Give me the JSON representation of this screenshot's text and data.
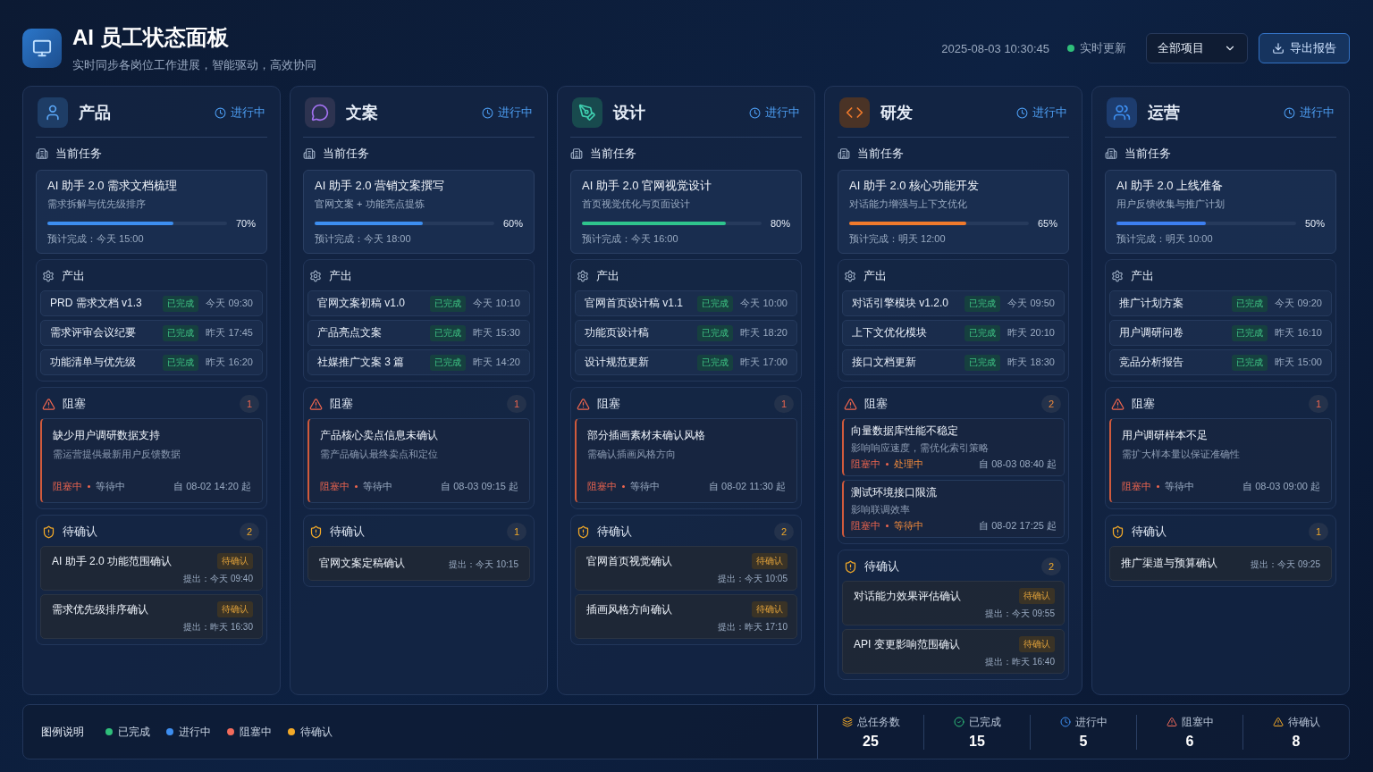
{
  "header": {
    "title": "AI 员工状态面板",
    "subtitle": "实时同步各岗位工作进展，智能驱动，高效协同",
    "datetime": "2025-08-03 10:30:45",
    "live": {
      "label": "实时更新",
      "color": "#2fbf7a"
    },
    "project_select": "全部项目",
    "export_button": "导出报告"
  },
  "columns": [
    {
      "name": "产品",
      "kind": "user",
      "status": "进行中",
      "task_label": "当前任务",
      "task": {
        "title": "AI 助手 2.0 需求文档梳理",
        "desc": "需求拆解与优先级排序",
        "level": 0.7,
        "percent": "70%",
        "color": "#3d8ef0",
        "eta": "预计完成：今天 15:00"
      },
      "outputs": {
        "label": "产出",
        "items": [
          {
            "name": "PRD 需求文档 v1.3",
            "status": "已完成",
            "time": "今天 09:30"
          },
          {
            "name": "需求评审会议纪要",
            "status": "已完成",
            "time": "昨天 17:45"
          },
          {
            "name": "功能清单与优先级",
            "status": "已完成",
            "time": "昨天 16:20"
          }
        ]
      },
      "blockers": {
        "label": "阻塞",
        "count": "1",
        "items": [
          {
            "kind": "spaced",
            "title": "缺少用户调研数据支持",
            "desc": "需运营提供最新用户反馈数据",
            "state": "阻塞中",
            "sub": "等待中",
            "since": "自 08-02 14:20 起"
          }
        ]
      },
      "pending": {
        "label": "待确认",
        "count": "2",
        "items": [
          {
            "kind": "stacked",
            "title": "AI 助手 2.0 功能范围确认",
            "tag": "待确认",
            "time": "提出：今天 09:40"
          },
          {
            "kind": "stacked",
            "title": "需求优先级排序确认",
            "tag": "待确认",
            "time": "提出：昨天 16:30"
          }
        ]
      }
    },
    {
      "name": "文案",
      "kind": "chat",
      "status": "进行中",
      "task_label": "当前任务",
      "task": {
        "title": "AI 助手 2.0 营销文案撰写",
        "desc": "官网文案 + 功能亮点提炼",
        "level": 0.6,
        "percent": "60%",
        "color": "#3d8ef0",
        "eta": "预计完成：今天 18:00"
      },
      "outputs": {
        "label": "产出",
        "items": [
          {
            "name": "官网文案初稿 v1.0",
            "status": "已完成",
            "time": "今天 10:10"
          },
          {
            "name": "产品亮点文案",
            "status": "已完成",
            "time": "昨天 15:30"
          },
          {
            "name": "社媒推广文案 3 篇",
            "status": "已完成",
            "time": "昨天 14:20"
          }
        ]
      },
      "blockers": {
        "label": "阻塞",
        "count": "1",
        "items": [
          {
            "kind": "spaced",
            "title": "产品核心卖点信息未确认",
            "desc": "需产品确认最终卖点和定位",
            "state": "阻塞中",
            "sub": "等待中",
            "since": "自 08-03 09:15 起"
          }
        ]
      },
      "pending": {
        "label": "待确认",
        "count": "1",
        "items": [
          {
            "kind": "inline",
            "title": "官网文案定稿确认",
            "time": "提出：今天 10:15"
          }
        ]
      }
    },
    {
      "name": "设计",
      "kind": "design",
      "status": "进行中",
      "task_label": "当前任务",
      "task": {
        "title": "AI 助手 2.0 官网视觉设计",
        "desc": "首页视觉优化与页面设计",
        "level": 0.8,
        "percent": "80%",
        "color": "#2fc48d",
        "eta": "预计完成：今天 16:00"
      },
      "outputs": {
        "label": "产出",
        "items": [
          {
            "name": "官网首页设计稿 v1.1",
            "status": "已完成",
            "time": "今天 10:00"
          },
          {
            "name": "功能页设计稿",
            "status": "已完成",
            "time": "昨天 18:20"
          },
          {
            "name": "设计规范更新",
            "status": "已完成",
            "time": "昨天 17:00"
          }
        ]
      },
      "blockers": {
        "label": "阻塞",
        "count": "1",
        "items": [
          {
            "kind": "spaced",
            "title": "部分插画素材未确认风格",
            "desc": "需确认插画风格方向",
            "state": "阻塞中",
            "sub": "等待中",
            "since": "自 08-02 11:30 起"
          }
        ]
      },
      "pending": {
        "label": "待确认",
        "count": "2",
        "items": [
          {
            "kind": "stacked",
            "title": "官网首页视觉确认",
            "tag": "待确认",
            "time": "提出：今天 10:05"
          },
          {
            "kind": "stacked",
            "title": "插画风格方向确认",
            "tag": "待确认",
            "time": "提出：昨天 17:10"
          }
        ]
      }
    },
    {
      "name": "研发",
      "kind": "code",
      "status": "进行中",
      "task_label": "当前任务",
      "task": {
        "title": "AI 助手 2.0 核心功能开发",
        "desc": "对话能力增强与上下文优化",
        "level": 0.65,
        "percent": "65%",
        "color": "#f07a2c",
        "eta": "预计完成：明天 12:00"
      },
      "outputs": {
        "label": "产出",
        "items": [
          {
            "name": "对话引擎模块 v1.2.0",
            "status": "已完成",
            "time": "今天 09:50"
          },
          {
            "name": "上下文优化模块",
            "status": "已完成",
            "time": "昨天 20:10"
          },
          {
            "name": "接口文档更新",
            "status": "已完成",
            "time": "昨天 18:30"
          }
        ]
      },
      "blockers": {
        "label": "阻塞",
        "count": "2",
        "items": [
          {
            "kind": "compact",
            "title": "向量数据库性能不稳定",
            "desc": "影响响应速度，需优化索引策略",
            "state": "阻塞中",
            "sub": "处理中",
            "since": "自 08-03 08:40 起"
          },
          {
            "kind": "compact",
            "title": "测试环境接口限流",
            "desc": "影响联调效率",
            "state": "阻塞中",
            "sub": "等待中",
            "since": "自 08-02 17:25 起"
          }
        ]
      },
      "pending": {
        "label": "待确认",
        "count": "2",
        "items": [
          {
            "kind": "stacked",
            "title": "对话能力效果评估确认",
            "tag": "待确认",
            "time": "提出：今天 09:55"
          },
          {
            "kind": "stacked",
            "title": "API 变更影响范围确认",
            "tag": "待确认",
            "time": "提出：昨天 16:40"
          }
        ]
      }
    },
    {
      "name": "运营",
      "kind": "team",
      "status": "进行中",
      "task_label": "当前任务",
      "task": {
        "title": "AI 助手 2.0 上线准备",
        "desc": "用户反馈收集与推广计划",
        "level": 0.5,
        "percent": "50%",
        "color": "#3d7ff0",
        "eta": "预计完成：明天 10:00"
      },
      "outputs": {
        "label": "产出",
        "items": [
          {
            "name": "推广计划方案",
            "status": "已完成",
            "time": "今天 09:20"
          },
          {
            "name": "用户调研问卷",
            "status": "已完成",
            "time": "昨天 16:10"
          },
          {
            "name": "竞品分析报告",
            "status": "已完成",
            "time": "昨天 15:00"
          }
        ]
      },
      "blockers": {
        "label": "阻塞",
        "count": "1",
        "items": [
          {
            "kind": "spaced",
            "title": "用户调研样本不足",
            "desc": "需扩大样本量以保证准确性",
            "state": "阻塞中",
            "sub": "等待中",
            "since": "自 08-03 09:00 起"
          }
        ]
      },
      "pending": {
        "label": "待确认",
        "count": "1",
        "items": [
          {
            "kind": "inline",
            "title": "推广渠道与预算确认",
            "time": "提出：今天 09:25"
          }
        ]
      }
    }
  ],
  "footer": {
    "legend_title": "图例说明",
    "legend": [
      {
        "label": "已完成",
        "color": "#2fbf7a"
      },
      {
        "label": "进行中",
        "color": "#3d8ef0"
      },
      {
        "label": "阻塞中",
        "color": "#f26b5b"
      },
      {
        "label": "待确认",
        "color": "#f2a928"
      }
    ],
    "stats": [
      {
        "kind": "total",
        "label": "总任务数",
        "value": "25"
      },
      {
        "kind": "done",
        "label": "已完成",
        "value": "15"
      },
      {
        "kind": "progress",
        "label": "进行中",
        "value": "5"
      },
      {
        "kind": "blocked",
        "label": "阻塞中",
        "value": "6"
      },
      {
        "kind": "pending",
        "label": "待确认",
        "value": "8"
      }
    ]
  }
}
